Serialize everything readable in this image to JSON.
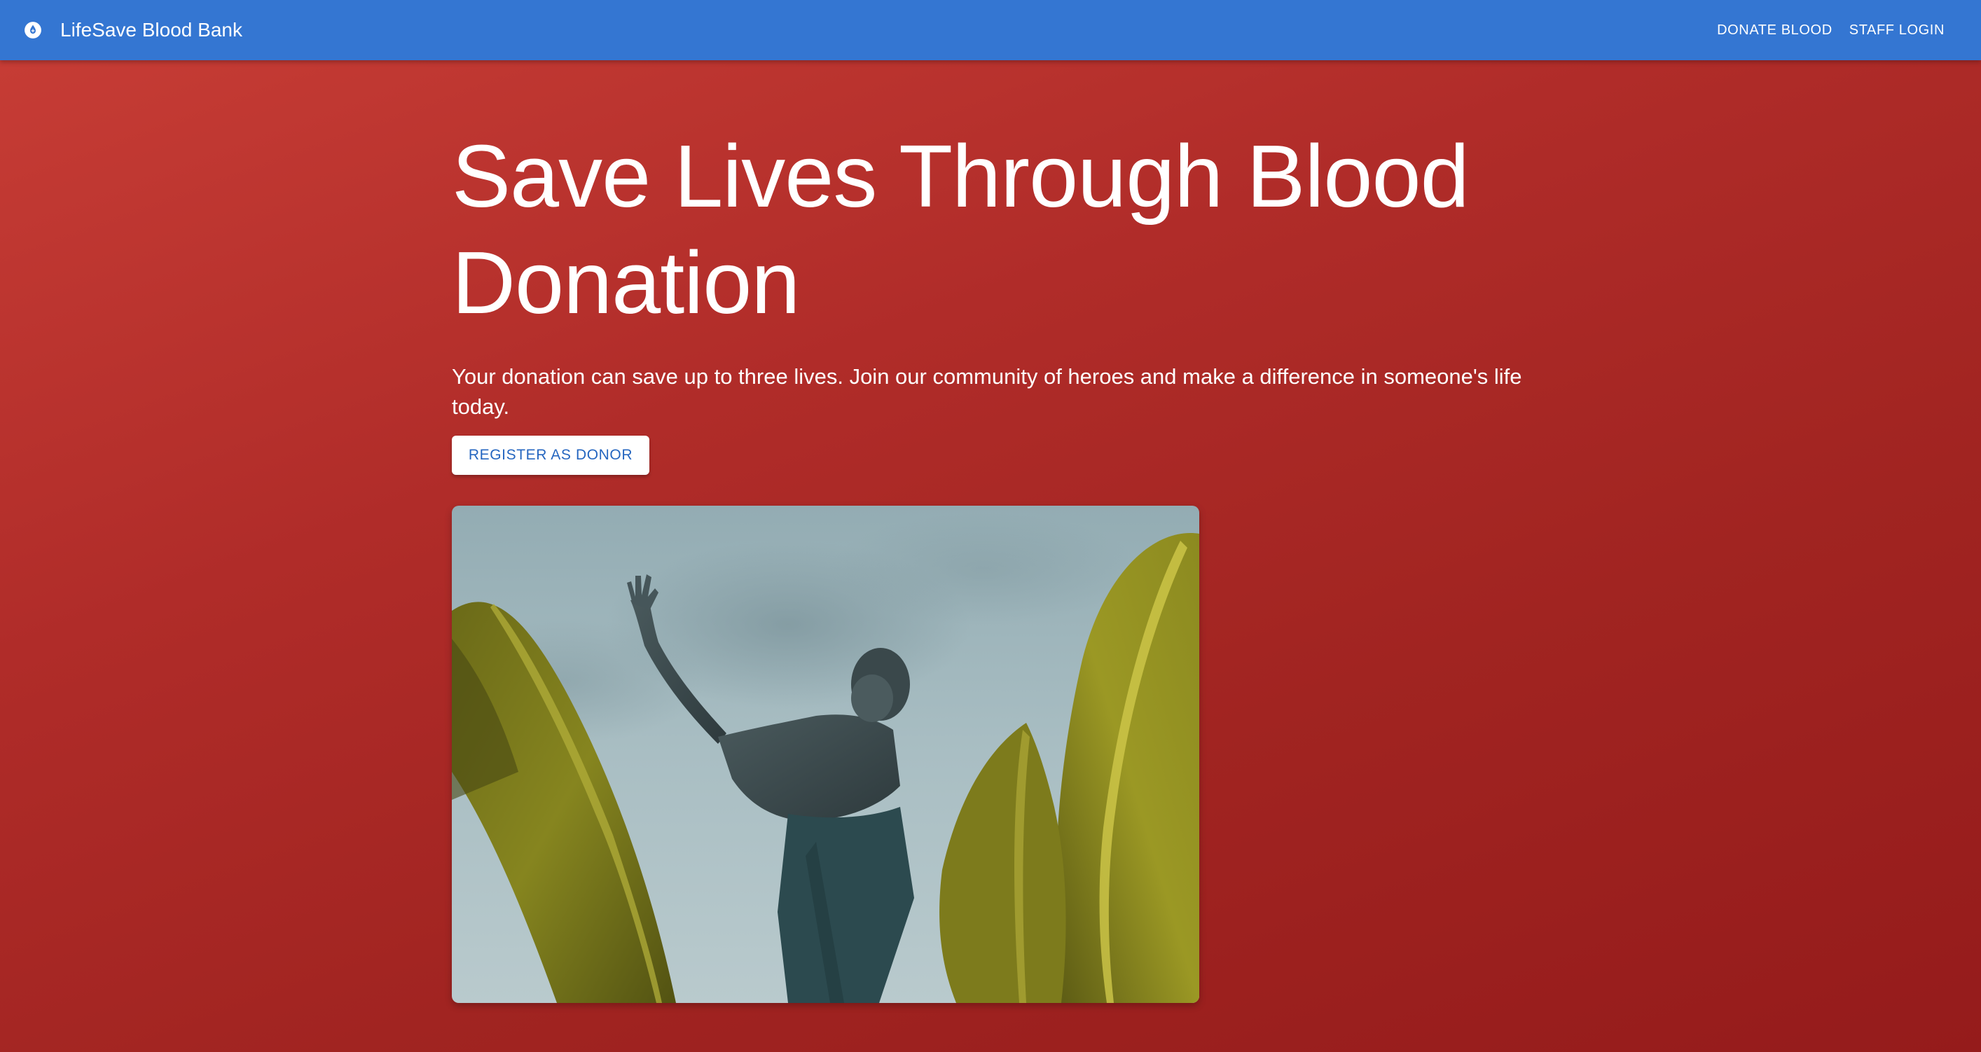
{
  "app": {
    "title": "LifeSave Blood Bank",
    "logo_icon": "blood-drop-icon"
  },
  "nav": {
    "items": [
      {
        "label": "DONATE BLOOD"
      },
      {
        "label": "STAFF LOGIN"
      }
    ]
  },
  "hero": {
    "title": "Save Lives Through Blood Donation",
    "subtitle": "Your donation can save up to three lives. Join our community of heroes and make a difference in someone's life today.",
    "cta_label": "REGISTER AS DONOR",
    "image_icon": "hero-photo-person-banana-leaves"
  },
  "colors": {
    "appbar": "#3476d2",
    "hero_gradient_start": "#c63c35",
    "hero_gradient_end": "#951b1b",
    "cta_text": "#2566c0",
    "white": "#ffffff"
  }
}
